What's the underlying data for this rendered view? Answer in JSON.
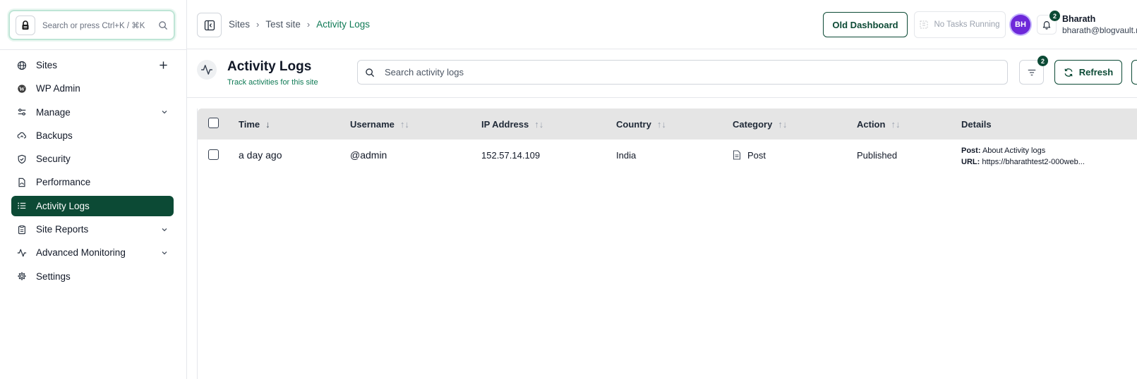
{
  "sidebar": {
    "search_placeholder": "Search or press Ctrl+K / ⌘K",
    "items": [
      {
        "label": "Sites",
        "icon": "globe-icon",
        "right": "plus"
      },
      {
        "label": "WP Admin",
        "icon": "wordpress-icon"
      },
      {
        "label": "Manage",
        "icon": "sliders-icon",
        "right": "chevron"
      },
      {
        "label": "Backups",
        "icon": "cloud-icon"
      },
      {
        "label": "Security",
        "icon": "shield-icon"
      },
      {
        "label": "Performance",
        "icon": "file-gauge-icon"
      },
      {
        "label": "Activity Logs",
        "icon": "list-icon",
        "active": true
      },
      {
        "label": "Site Reports",
        "icon": "clipboard-icon",
        "right": "chevron"
      },
      {
        "label": "Advanced Monitoring",
        "icon": "activity-icon",
        "right": "chevron"
      },
      {
        "label": "Settings",
        "icon": "gear-icon"
      }
    ]
  },
  "header": {
    "breadcrumb": [
      "Sites",
      "Test site",
      "Activity Logs"
    ],
    "old_dashboard": "Old Dashboard",
    "tasks": "No Tasks Running",
    "avatar_initials": "BH",
    "notifications_count": "2",
    "user_name": "Bharath",
    "user_email": "bharath@blogvault.n"
  },
  "page": {
    "title": "Activity Logs",
    "subtitle": "Track activities for this site",
    "search_placeholder": "Search activity logs",
    "filter_count": "2",
    "refresh_label": "Refresh"
  },
  "colors": {
    "accent": "#0c4a35",
    "accent_text": "#0f7a55",
    "avatar": "#6d28d9",
    "table_header": "#e5e5e5"
  },
  "table": {
    "columns": [
      "Time",
      "Username",
      "IP Address",
      "Country",
      "Category",
      "Action",
      "Details"
    ],
    "rows": [
      {
        "time": "a day ago",
        "username": "@admin",
        "ip": "152.57.14.109",
        "country": "India",
        "category": "Post",
        "action": "Published",
        "details_post_label": "Post:",
        "details_post": "About Activity logs",
        "details_url_label": "URL:",
        "details_url": "https://bharathtest2-000web..."
      }
    ]
  }
}
